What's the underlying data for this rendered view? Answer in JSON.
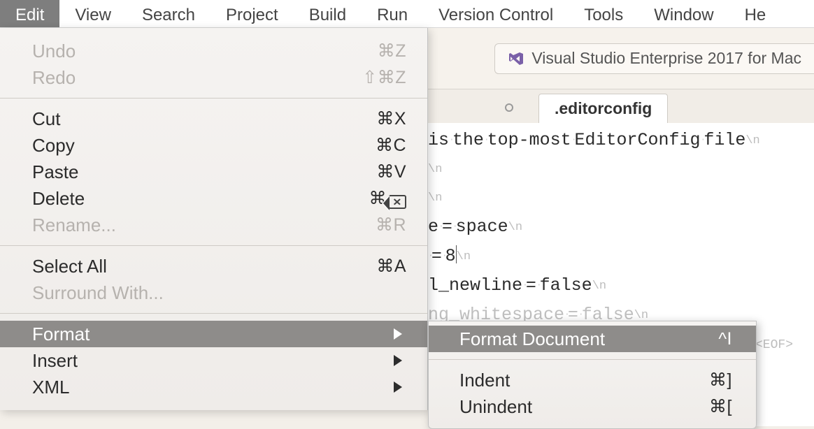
{
  "menubar": {
    "items": [
      "Edit",
      "View",
      "Search",
      "Project",
      "Build",
      "Run",
      "Version Control",
      "Tools",
      "Window",
      "He"
    ],
    "selected_index": 0
  },
  "edit_menu": {
    "groups": [
      [
        {
          "label": "Undo",
          "shortcut": "⌘Z",
          "enabled": false
        },
        {
          "label": "Redo",
          "shortcut": "⇧⌘Z",
          "enabled": false
        }
      ],
      [
        {
          "label": "Cut",
          "shortcut": "⌘X",
          "enabled": true
        },
        {
          "label": "Copy",
          "shortcut": "⌘C",
          "enabled": true
        },
        {
          "label": "Paste",
          "shortcut": "⌘V",
          "enabled": true
        },
        {
          "label": "Delete",
          "shortcut": "⌘⌫",
          "enabled": true,
          "bksp": true
        },
        {
          "label": "Rename...",
          "shortcut": "⌘R",
          "enabled": false
        }
      ],
      [
        {
          "label": "Select All",
          "shortcut": "⌘A",
          "enabled": true
        },
        {
          "label": "Surround With...",
          "shortcut": "",
          "enabled": false
        }
      ],
      [
        {
          "label": "Format",
          "submenu": true,
          "enabled": true,
          "highlight": true
        },
        {
          "label": "Insert",
          "submenu": true,
          "enabled": true
        },
        {
          "label": "XML",
          "submenu": true,
          "enabled": true
        }
      ]
    ]
  },
  "format_submenu": {
    "items": [
      {
        "label": "Format Document",
        "shortcut": "^I",
        "highlight": true
      },
      {
        "sep": true
      },
      {
        "label": "Indent",
        "shortcut": "⌘]"
      },
      {
        "label": "Unindent",
        "shortcut": "⌘["
      }
    ]
  },
  "ribbon": {
    "title": "Visual Studio Enterprise 2017 for Mac"
  },
  "tab": {
    "filename": ".editorconfig"
  },
  "code_lines": [
    {
      "t": "is·the·top-most·EditorConfig·file",
      "nl": "\\n"
    },
    {
      "t": "",
      "nl": "\\n"
    },
    {
      "t": "",
      "nl": ""
    },
    {
      "t": "",
      "nl": "\\n"
    },
    {
      "t": "e·=·space",
      "nl": "\\n"
    },
    {
      "t": "·=·8",
      "caret": true,
      "nl": "\\n"
    },
    {
      "t": "l_newline·=·false",
      "nl": "\\n"
    },
    {
      "t": "ng_whitespace·=·false",
      "nl": "\\n",
      "faded": true
    },
    {
      "t": "",
      "nl": ""
    },
    {
      "t": "",
      "eof": "<EOF>"
    }
  ]
}
